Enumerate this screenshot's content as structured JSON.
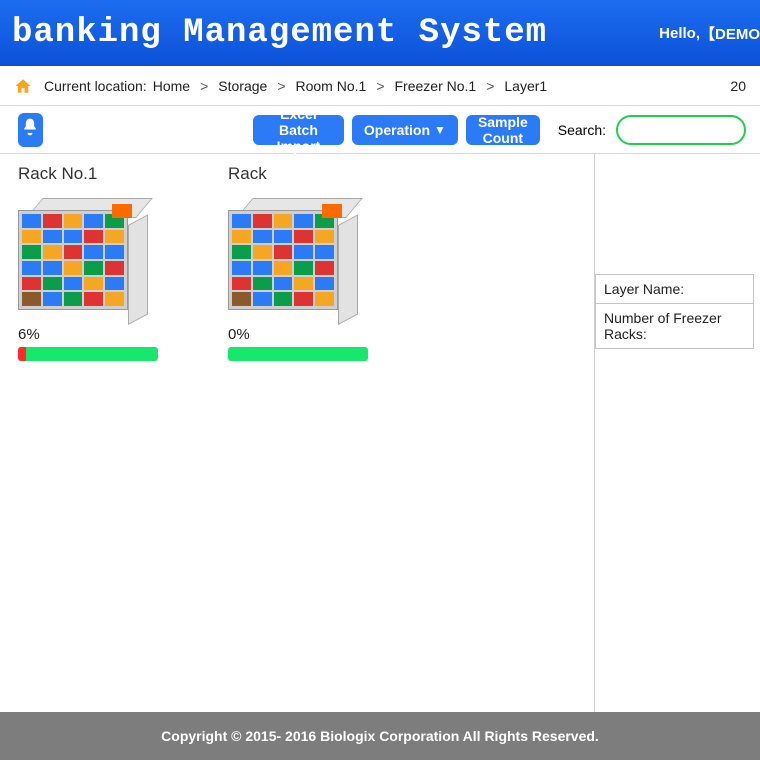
{
  "header": {
    "title_visible": "banking Management System",
    "greeting_prefix": "Hello, ",
    "user": "【DEMO"
  },
  "breadcrumb": {
    "label": "Current location:",
    "items": [
      "Home",
      "Storage",
      "Room No.1",
      "Freezer No.1",
      "Layer1"
    ],
    "date_partial": "20"
  },
  "toolbar": {
    "excel_import": "Excel Batch Import",
    "operation": "Operation",
    "sample_count": "Sample Count",
    "search_label": "Search:",
    "search_placeholder": ""
  },
  "racks": [
    {
      "title": "Rack No.1",
      "percent_text": "6%",
      "percent_value": 6
    },
    {
      "title": "Rack",
      "percent_text": "0%",
      "percent_value": 0
    }
  ],
  "sidebar": {
    "layer_name_label": "Layer Name:",
    "num_racks_label": "Number of Freezer Racks:"
  },
  "footer": {
    "text": "Copyright © 2015- 2016   Biologix Corporation All Rights Reserved."
  },
  "colors": {
    "primary": "#2a7bf5",
    "progress_green": "#17e86c",
    "progress_red": "#ff2a2a"
  }
}
